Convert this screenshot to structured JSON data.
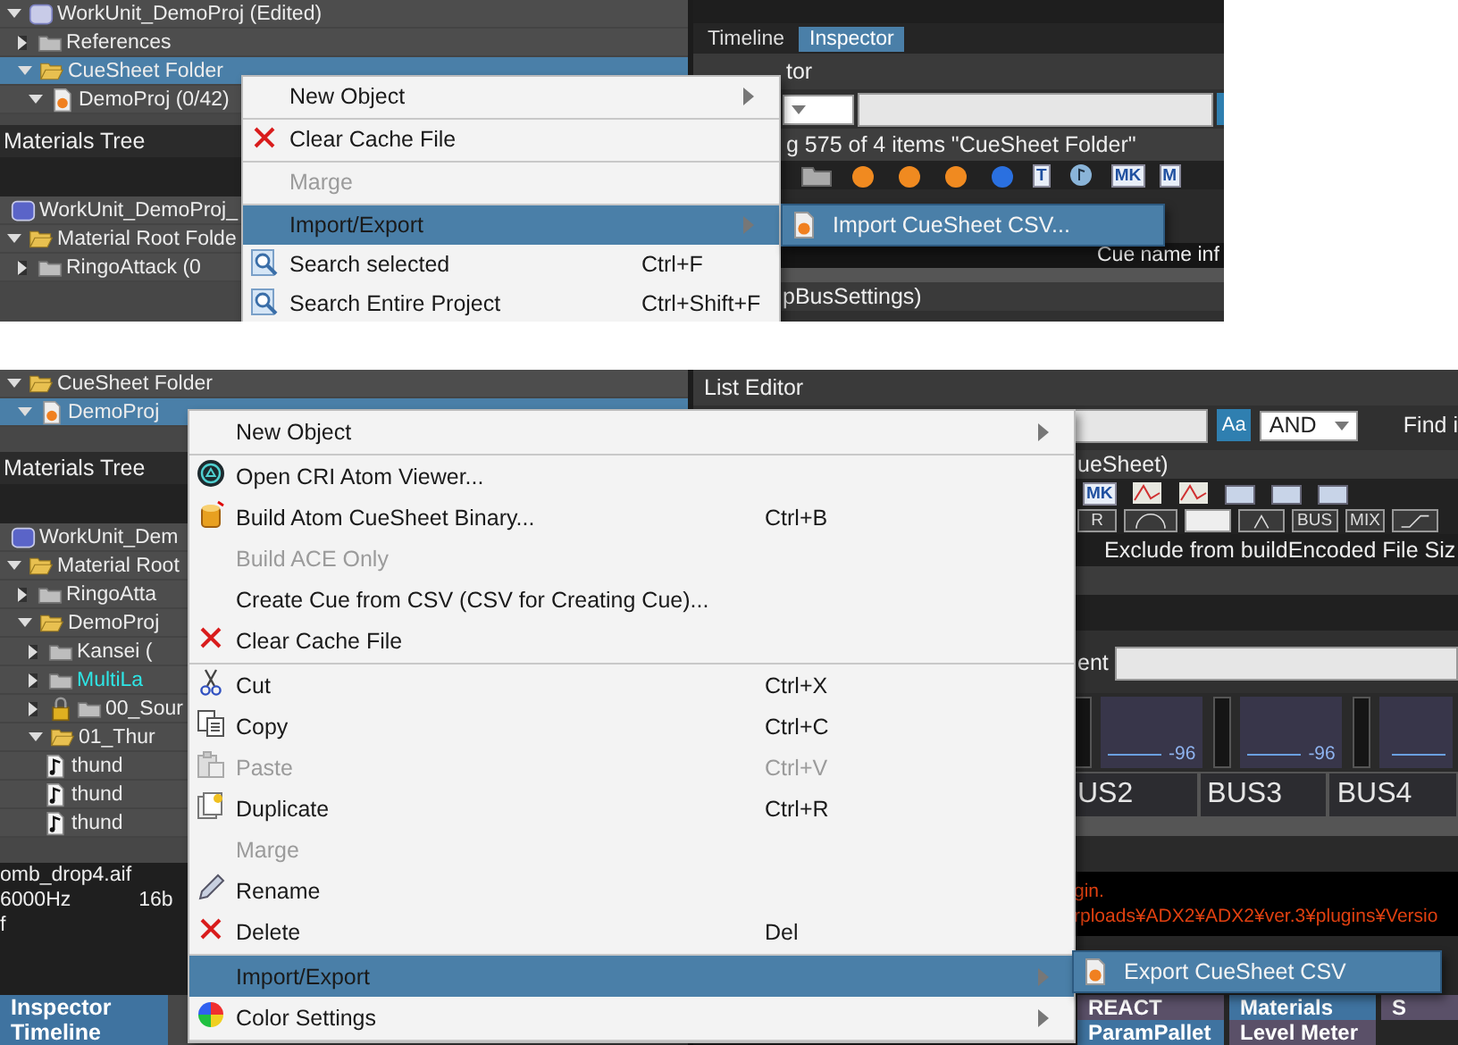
{
  "top_view": {
    "cue_tree": [
      {
        "label": "WorkUnit_DemoProj (Edited)",
        "kind": "workunit",
        "expanded": true,
        "selected": false,
        "children": [
          {
            "label": "References",
            "kind": "folder",
            "expanded": false,
            "selected": false
          },
          {
            "label": "CueSheet Folder",
            "kind": "folder_open",
            "expanded": true,
            "selected": true,
            "children": [
              {
                "label": "DemoProj (0/42)",
                "kind": "cuesheet",
                "expanded": true,
                "selected": false
              }
            ]
          }
        ]
      }
    ],
    "materials_title": "Materials Tree",
    "materials_tree": [
      {
        "label": "WorkUnit_DemoProj_",
        "kind": "material_unit",
        "selected": false
      },
      {
        "label": "Material Root Folde",
        "kind": "folder_open",
        "expanded": true,
        "selected": false,
        "children": [
          {
            "label": "RingoAttack (0",
            "kind": "folder",
            "expanded": false,
            "selected": false
          }
        ]
      }
    ],
    "tabs": [
      {
        "label": "Timeline",
        "selected": false
      },
      {
        "label": "Inspector",
        "selected": true
      }
    ],
    "list_editor_title": "tor",
    "status_text": "g 575 of 4 items  \"CueSheet Folder\"",
    "toolbar_icons": [
      {
        "kind": "folder"
      },
      {
        "kind": "sphere"
      },
      {
        "kind": "sphere"
      },
      {
        "kind": "sphere"
      },
      {
        "kind": "sphere2"
      },
      {
        "kind": "text",
        "label": "T"
      },
      {
        "kind": "note"
      },
      {
        "kind": "text",
        "label": "MK"
      },
      {
        "kind": "text",
        "label": "M"
      }
    ],
    "column_text": "Cue name inf",
    "footer_text": "pBusSettings)",
    "menu": [
      {
        "kind": "plain",
        "label": "New Object",
        "submenu": true,
        "selected": false,
        "disabled": false
      },
      {
        "kind": "separator"
      },
      {
        "kind": "cross",
        "label": "Clear Cache File",
        "submenu": false,
        "selected": false,
        "disabled": false
      },
      {
        "kind": "separator"
      },
      {
        "kind": "plain",
        "label": "Marge",
        "submenu": false,
        "selected": false,
        "disabled": true
      },
      {
        "kind": "separator"
      },
      {
        "kind": "plain",
        "label": "Import/Export",
        "submenu": true,
        "selected": true,
        "disabled": false
      },
      {
        "kind": "search",
        "label": "Search selected",
        "shortcut": "Ctrl+F",
        "submenu": false,
        "selected": false,
        "disabled": false
      },
      {
        "kind": "search",
        "label": "Search Entire Project",
        "shortcut": "Ctrl+Shift+F",
        "submenu": false,
        "selected": false,
        "disabled": false
      }
    ],
    "submenu": [
      {
        "label": "Import CueSheet CSV...",
        "kind": "cuesheet"
      }
    ]
  },
  "bottom_view": {
    "cue_tree": [
      {
        "label": "CueSheet Folder",
        "kind": "folder_open",
        "expanded": true,
        "selected": false,
        "children": [
          {
            "label": "DemoProj",
            "kind": "cuesheet",
            "expanded": true,
            "selected": true
          }
        ]
      }
    ],
    "materials_title": "Materials Tree",
    "materials_tree": [
      {
        "label": "WorkUnit_Dem",
        "kind": "material_unit",
        "selected": false,
        "locked": false
      },
      {
        "label": "Material Root",
        "kind": "folder_open",
        "expanded": true,
        "selected": false,
        "locked": false,
        "children": [
          {
            "label": "RingoAtta",
            "kind": "folder",
            "expanded": false,
            "selected": false,
            "locked": false
          },
          {
            "label": "DemoProj",
            "kind": "folder_open",
            "expanded": true,
            "selected": false,
            "locked": false,
            "children": [
              {
                "label": "Kansei (",
                "kind": "folder",
                "expanded": false,
                "selected": false,
                "locked": false
              },
              {
                "label": "MultiLa",
                "kind": "folder",
                "expanded": false,
                "selected": false,
                "locked": false,
                "color": "#2ee6e6"
              },
              {
                "label": "00_Sour",
                "kind": "folder",
                "expanded": false,
                "selected": false,
                "locked": true
              },
              {
                "label": "01_Thur",
                "kind": "folder_open",
                "expanded": true,
                "selected": false,
                "locked": false,
                "children": [
                  {
                    "label": "thund",
                    "kind": "wave",
                    "selected": false,
                    "locked": false
                  },
                  {
                    "label": "thund",
                    "kind": "wave",
                    "selected": false,
                    "locked": false
                  },
                  {
                    "label": "thund",
                    "kind": "wave",
                    "selected": false,
                    "locked": false
                  }
                ]
              }
            ]
          }
        ]
      }
    ],
    "file_info": {
      "name": "omb_drop4.aif",
      "rate": "6000Hz",
      "bits": "16b",
      "line_3": "f"
    },
    "left_tabs": [
      {
        "label": "Inspector"
      },
      {
        "label": "Timeline"
      }
    ],
    "list_editor_title": "List Editor",
    "case_button": "Aa",
    "match_mode": "AND",
    "find_label": "Find i",
    "cuesheet_text": "ueSheet)",
    "toolbar_icons": [
      {
        "kind": "text",
        "label": "MK"
      },
      {
        "kind": "graph"
      },
      {
        "kind": "graph"
      },
      {
        "kind": "tile"
      },
      {
        "kind": "tile"
      },
      {
        "kind": "tile"
      }
    ],
    "toolbar_buttons": [
      {
        "kind": "text",
        "label": "R"
      },
      {
        "kind": "dial"
      },
      {
        "kind": "blank"
      },
      {
        "kind": "triangle"
      },
      {
        "kind": "text",
        "label": "BUS"
      },
      {
        "kind": "text",
        "label": "MIX"
      },
      {
        "kind": "slope"
      }
    ],
    "columns": [
      "Exclude from build",
      "Encoded File Siz"
    ],
    "comment_label": "ent",
    "mixer": [
      {
        "name": "US2",
        "reading": "-96"
      },
      {
        "name": "BUS3",
        "reading": "-96"
      },
      {
        "name": "BUS4"
      }
    ],
    "log_lines": [
      "gin.",
      "rploads¥ADX2¥ADX2¥ver.3¥plugins¥Versio"
    ],
    "bottom_tabs": [
      [
        {
          "label": "REACT",
          "selected": false
        },
        {
          "label": "Materials",
          "selected": true
        },
        {
          "label": "S",
          "selected": false
        }
      ],
      [
        {
          "label": "ParamPallet",
          "selected": true
        },
        {
          "label": "Level Meter",
          "selected": false
        }
      ]
    ],
    "menu": [
      {
        "kind": "plain",
        "label": "New Object",
        "submenu": true,
        "selected": false,
        "disabled": false
      },
      {
        "kind": "separator"
      },
      {
        "kind": "atom",
        "label": "Open CRI Atom Viewer...",
        "submenu": false,
        "selected": false,
        "disabled": false
      },
      {
        "kind": "build",
        "label": "Build Atom CueSheet Binary...",
        "shortcut": "Ctrl+B",
        "submenu": false,
        "selected": false,
        "disabled": false
      },
      {
        "kind": "plain",
        "label": "Build ACE Only",
        "submenu": false,
        "selected": false,
        "disabled": true
      },
      {
        "kind": "plain",
        "label": "Create Cue from CSV (CSV for Creating Cue)...",
        "submenu": false,
        "selected": false,
        "disabled": false
      },
      {
        "kind": "cross",
        "label": "Clear Cache File",
        "submenu": false,
        "selected": false,
        "disabled": false
      },
      {
        "kind": "separator"
      },
      {
        "kind": "scissors",
        "label": "Cut",
        "shortcut": "Ctrl+X",
        "submenu": false,
        "selected": false,
        "disabled": false
      },
      {
        "kind": "copy",
        "label": "Copy",
        "shortcut": "Ctrl+C",
        "submenu": false,
        "selected": false,
        "disabled": false
      },
      {
        "kind": "paste",
        "label": "Paste",
        "shortcut": "Ctrl+V",
        "submenu": false,
        "selected": false,
        "disabled": true
      },
      {
        "kind": "duplicate",
        "label": "Duplicate",
        "shortcut": "Ctrl+R",
        "submenu": false,
        "selected": false,
        "disabled": false
      },
      {
        "kind": "plain",
        "label": "Marge",
        "submenu": false,
        "selected": false,
        "disabled": true
      },
      {
        "kind": "pencil",
        "label": "Rename",
        "submenu": false,
        "selected": false,
        "disabled": false
      },
      {
        "kind": "cross",
        "label": "Delete",
        "shortcut": "Del",
        "submenu": false,
        "selected": false,
        "disabled": false
      },
      {
        "kind": "separator"
      },
      {
        "kind": "plain",
        "label": "Import/Export",
        "submenu": true,
        "selected": true,
        "disabled": false
      },
      {
        "kind": "color",
        "label": "Color Settings",
        "submenu": true,
        "selected": false,
        "disabled": false
      },
      {
        "kind": "separator"
      }
    ],
    "submenu": [
      {
        "label": "Export CueSheet CSV",
        "kind": "cuesheet"
      }
    ]
  }
}
